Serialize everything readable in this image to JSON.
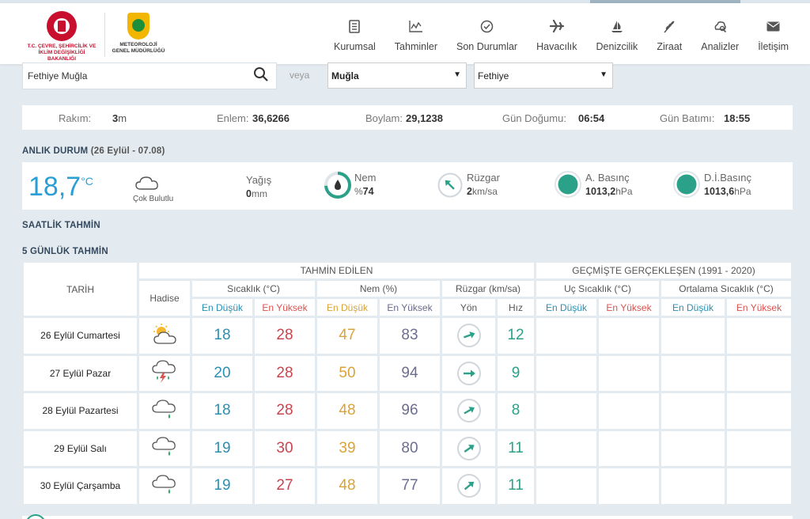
{
  "header": {
    "ministry_text": "T.C. ÇEVRE, ŞEHİRCİLİK VE\nİKLİM DEĞİŞİKLİĞİ BAKANLIĞI",
    "mgm_text": "METEOROLOJİ\nGENEL MÜDÜRLÜĞÜ",
    "nav": [
      {
        "label": "Kurumsal",
        "icon": "document-icon"
      },
      {
        "label": "Tahminler",
        "icon": "chart-icon"
      },
      {
        "label": "Son Durumlar",
        "icon": "check-circle-icon"
      },
      {
        "label": "Havacılık",
        "icon": "airplane-icon"
      },
      {
        "label": "Denizcilik",
        "icon": "sailboat-icon"
      },
      {
        "label": "Ziraat",
        "icon": "wheat-icon"
      },
      {
        "label": "Analizler",
        "icon": "analysis-icon"
      },
      {
        "label": "İletişim",
        "icon": "envelope-icon"
      }
    ]
  },
  "search": {
    "value": "Fethiye Muğla",
    "or_label": "veya",
    "province": "Muğla",
    "district": "Fethiye"
  },
  "info": {
    "rakim_label": "Rakım:",
    "rakim_value": "3",
    "rakim_unit": "m",
    "enlem_label": "Enlem:",
    "enlem_value": "36,6266",
    "boylam_label": "Boylam:",
    "boylam_value": "29,1238",
    "gundogumu_label": "Gün Doğumu:",
    "gundogumu_value": "06:54",
    "gunbatimi_label": "Gün Batımı:",
    "gunbatimi_value": "18:55"
  },
  "current": {
    "title": "ANLIK DURUM",
    "subtitle": "(26 Eylül - 07.08)",
    "temp": "18,7",
    "temp_unit": "°C",
    "condition": "Çok Bulutlu",
    "yagis_label": "Yağış",
    "yagis_value": "0",
    "yagis_unit": "mm",
    "nem_label": "Nem",
    "nem_prefix": "%",
    "nem_value": "74",
    "nem_fraction": 0.74,
    "ruzgar_label": "Rüzgar",
    "ruzgar_value": "2",
    "ruzgar_unit": "km/sa",
    "abasinc_label": "A. Basınç",
    "abasinc_value": "1013,2",
    "abasinc_unit": "hPa",
    "dibasinc_label": "D.İ.Basınç",
    "dibasinc_value": "1013,6",
    "dibasinc_unit": "hPa"
  },
  "hourly_title": "SAATLİK TAHMİN",
  "daily_title": "5 GÜNLÜK TAHMİN",
  "table": {
    "tarih": "TARİH",
    "hadise": "Hadise",
    "tahmin_edilen": "TAHMİN EDİLEN",
    "gecmiste": "GEÇMİŞTE GERÇEKLEŞEN (1991 - 2020)",
    "sicaklik": "Sıcaklık (°C)",
    "nem": "Nem (%)",
    "ruzgar": "Rüzgar (km/sa)",
    "uc_sicaklik": "Uç Sıcaklık (°C)",
    "ort_sicaklik": "Ortalama Sıcaklık (°C)",
    "en_dusuk": "En Düşük",
    "en_yuksek": "En Yüksek",
    "yon": "Yön",
    "hiz": "Hız",
    "rows": [
      {
        "date": "26 Eylül Cumartesi",
        "icon": "sun-cloud-icon",
        "tmin": "18",
        "tmax": "28",
        "hmin": "47",
        "hmax": "83",
        "wind_deg": -20,
        "speed": "12"
      },
      {
        "date": "27 Eylül Pazar",
        "icon": "thunderstorm-icon",
        "tmin": "20",
        "tmax": "28",
        "hmin": "50",
        "hmax": "94",
        "wind_deg": 0,
        "speed": "9"
      },
      {
        "date": "28 Eylül Pazartesi",
        "icon": "rain-cloud-icon",
        "tmin": "18",
        "tmax": "28",
        "hmin": "48",
        "hmax": "96",
        "wind_deg": -30,
        "speed": "8"
      },
      {
        "date": "29 Eylül Salı",
        "icon": "rain-cloud-icon",
        "tmin": "19",
        "tmax": "30",
        "hmin": "39",
        "hmax": "80",
        "wind_deg": -35,
        "speed": "11"
      },
      {
        "date": "30 Eylül Çarşamba",
        "icon": "rain-cloud-icon",
        "tmin": "19",
        "tmax": "27",
        "hmin": "48",
        "hmax": "77",
        "wind_deg": -40,
        "speed": "11"
      }
    ]
  }
}
